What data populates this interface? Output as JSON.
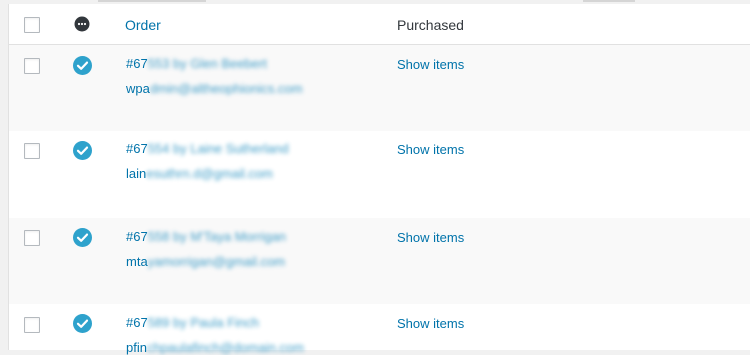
{
  "table": {
    "headers": {
      "order": "Order",
      "purchased": "Purchased"
    },
    "rows": [
      {
        "order_prefix": "#67",
        "order_blur": "553 by Glen Beebert",
        "email_prefix": "wpa",
        "email_blur": "dmin@altheophionics.com",
        "purchased_link": "Show items"
      },
      {
        "order_prefix": "#67",
        "order_blur": "554 by Laine Sutherland",
        "email_prefix": "lain",
        "email_blur": "esuthrn.d@gmail.com",
        "purchased_link": "Show items"
      },
      {
        "order_prefix": "#67",
        "order_blur": "558 by M'Taya Morrigan",
        "email_prefix": "mta",
        "email_blur": "yamorrigan@gmail.com",
        "purchased_link": "Show items"
      },
      {
        "order_prefix": "#67",
        "order_blur": "589 by Paula Finch",
        "email_prefix": "pfin",
        "email_blur": "chpaulafinch@domain.com",
        "purchased_link": "Show items"
      }
    ]
  },
  "colors": {
    "link": "#0073aa",
    "status_complete": "#2ea2cc",
    "status_header": "#32373c"
  }
}
